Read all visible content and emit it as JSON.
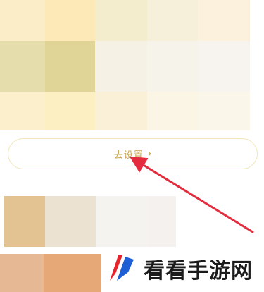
{
  "settings_button": {
    "label": "去设置",
    "chevron": "›",
    "text_color": "#c9a34a",
    "border_color": "#f2e6b8"
  },
  "palette_swatches_top": {
    "colors": [
      "#fbedc7",
      "#fde9b7",
      "#f3eccd",
      "#f6efd9",
      "#fbf1dc",
      "#e5ddab",
      "#e0d597",
      "#f5f1e4",
      "#f6f3ea",
      "#f7f3ee",
      "#fcefcb",
      "#fcf0c3",
      "#f9f0d7",
      "#faf5e4",
      "#faf7ea"
    ]
  },
  "palette_swatches_bottom": {
    "colors": [
      "#e2c391",
      "#ebe2d2",
      "#f5f3ef",
      "#f4f1ee"
    ],
    "bottom_colors": [
      "#e6b894",
      "#e6a876"
    ]
  },
  "annotation_arrow": {
    "color": "#e32c3d"
  },
  "watermark": {
    "text": "看看手游网",
    "logo_colors": [
      "#e8232b",
      "#1f5fd6"
    ]
  }
}
